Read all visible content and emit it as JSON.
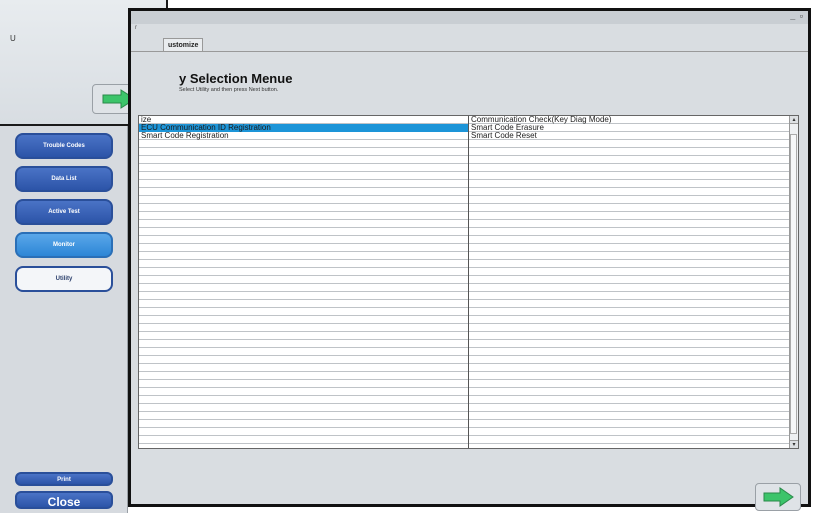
{
  "popup": {
    "text": "U",
    "scroll_glyph": "▾"
  },
  "window": {
    "controls": "_ ▫",
    "subtitle": "r",
    "tab_label": "ustomize",
    "heading": "y Selection Menue",
    "instruction": "Select Utility and then press Next button."
  },
  "table": {
    "columns": [
      "c1",
      "c2"
    ],
    "rows": [
      {
        "c1": "ize",
        "c2": "Communication Check(Key Diag Mode)",
        "selected": false
      },
      {
        "c1": "ECU Communication ID Registration",
        "c2": "Smart Code Erasure",
        "selected": true
      },
      {
        "c1": "Smart Code Registration",
        "c2": "Smart Code Reset",
        "selected": false
      },
      {
        "c1": "",
        "c2": "",
        "selected": false
      },
      {
        "c1": "",
        "c2": "",
        "selected": false
      },
      {
        "c1": "",
        "c2": "",
        "selected": false
      },
      {
        "c1": "",
        "c2": "",
        "selected": false
      },
      {
        "c1": "",
        "c2": "",
        "selected": false
      },
      {
        "c1": "",
        "c2": "",
        "selected": false
      },
      {
        "c1": "",
        "c2": "",
        "selected": false
      },
      {
        "c1": "",
        "c2": "",
        "selected": false
      },
      {
        "c1": "",
        "c2": "",
        "selected": false
      },
      {
        "c1": "",
        "c2": "",
        "selected": false
      },
      {
        "c1": "",
        "c2": "",
        "selected": false
      },
      {
        "c1": "",
        "c2": "",
        "selected": false
      },
      {
        "c1": "",
        "c2": "",
        "selected": false
      },
      {
        "c1": "",
        "c2": "",
        "selected": false
      },
      {
        "c1": "",
        "c2": "",
        "selected": false
      },
      {
        "c1": "",
        "c2": "",
        "selected": false
      },
      {
        "c1": "",
        "c2": "",
        "selected": false
      },
      {
        "c1": "",
        "c2": "",
        "selected": false
      },
      {
        "c1": "",
        "c2": "",
        "selected": false
      },
      {
        "c1": "",
        "c2": "",
        "selected": false
      },
      {
        "c1": "",
        "c2": "",
        "selected": false
      },
      {
        "c1": "",
        "c2": "",
        "selected": false
      },
      {
        "c1": "",
        "c2": "",
        "selected": false
      },
      {
        "c1": "",
        "c2": "",
        "selected": false
      },
      {
        "c1": "",
        "c2": "",
        "selected": false
      },
      {
        "c1": "",
        "c2": "",
        "selected": false
      },
      {
        "c1": "",
        "c2": "",
        "selected": false
      },
      {
        "c1": "",
        "c2": "",
        "selected": false
      },
      {
        "c1": "",
        "c2": "",
        "selected": false
      },
      {
        "c1": "",
        "c2": "",
        "selected": false
      },
      {
        "c1": "",
        "c2": "",
        "selected": false
      },
      {
        "c1": "",
        "c2": "",
        "selected": false
      },
      {
        "c1": "",
        "c2": "",
        "selected": false
      },
      {
        "c1": "",
        "c2": "",
        "selected": false
      },
      {
        "c1": "",
        "c2": "",
        "selected": false
      },
      {
        "c1": "",
        "c2": "",
        "selected": false
      },
      {
        "c1": "",
        "c2": "",
        "selected": false
      },
      {
        "c1": "",
        "c2": "",
        "selected": false
      }
    ],
    "scroll_up": "▴",
    "scroll_down": "▾"
  },
  "sidebar": {
    "buttons": [
      {
        "label": "Trouble Codes",
        "style": "dark"
      },
      {
        "label": "Data List",
        "style": "dark"
      },
      {
        "label": "Active Test",
        "style": "dark"
      },
      {
        "label": "Monitor",
        "style": "light"
      },
      {
        "label": "Utility",
        "style": "util"
      }
    ],
    "print_label": "Print",
    "close_label": "Close"
  },
  "colors": {
    "selection": "#1d95d8",
    "button_dark": "#2c54a8",
    "arrow_fill": "#3cc46a"
  },
  "icons": {
    "next": "green-right-arrow"
  }
}
